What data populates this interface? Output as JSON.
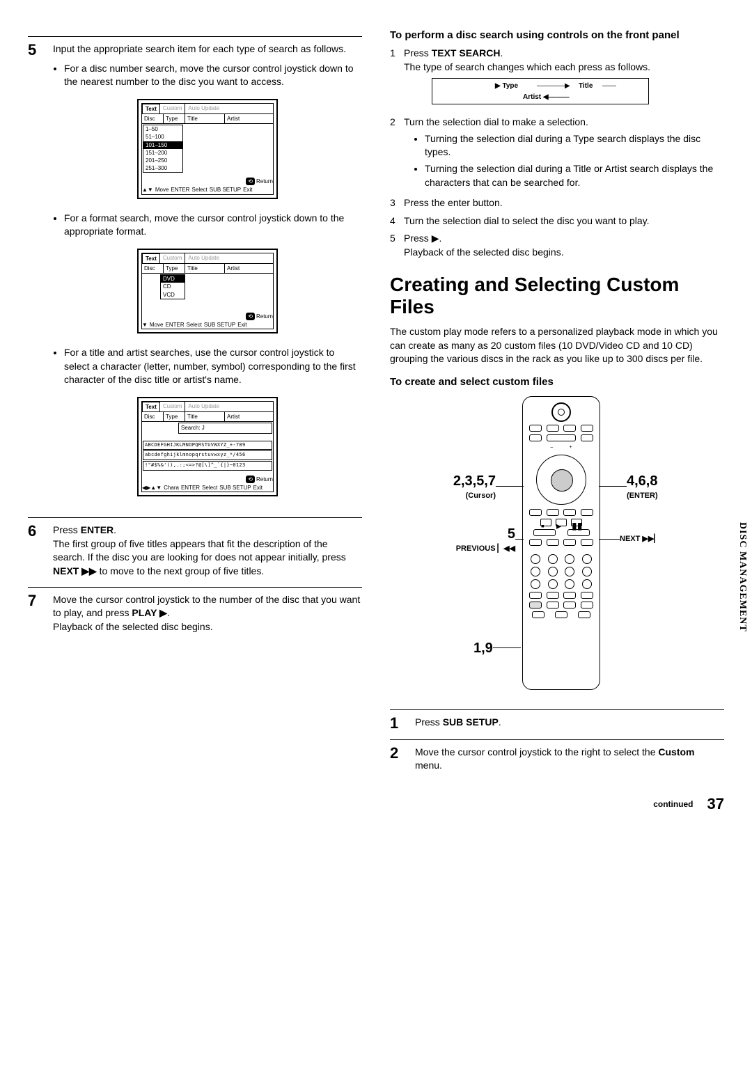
{
  "sideTab": "DISC MANAGEMENT",
  "pageNumber": "37",
  "continued": "continued",
  "left": {
    "step5": {
      "num": "5",
      "text": "Input the appropriate search item for each type of search as follows.",
      "b1": "For a disc number search, move the cursor control joystick down to the nearest number to the disc you want to access.",
      "fig1": {
        "t_text": "Text",
        "t_custom": "Custom",
        "t_auto": "Auto Update",
        "h_disc": "Disc",
        "h_type": "Type",
        "h_title": "Title",
        "h_artist": "Artist",
        "r1": "1–50",
        "r2": "51–100",
        "r3": "101–150",
        "r4": "151–200",
        "r5": "201–250",
        "r6": "251–300",
        "ret": "Return",
        "move": "Move",
        "enter": "ENTER",
        "select": "Select",
        "sub": "SUB SETUP",
        "exit": "Exit"
      },
      "b2": "For a format search, move the cursor control joystick down to the appropriate format.",
      "fig2": {
        "opt1": "DVD",
        "opt2": "CD",
        "opt3": "VCD"
      },
      "b3": "For a title and artist searches, use the cursor control joystick to select a character (letter, number, symbol) corresponding to the first character of the disc title or artist's name.",
      "fig3": {
        "search": "Search: J",
        "row1": "ABCDEFGHIJKLMNOPQRSTUVWXYZ_+-789",
        "row2": "abcdefghijklmnopqrstuvwxyz_*/456",
        "row3": "!\"#$%&'(),.:;<=>?@[\\]^_`{|}~0123",
        "chara": "Chara"
      }
    },
    "step6": {
      "num": "6",
      "press": "Press ",
      "enter": "ENTER",
      "period": ".",
      "para": "The first group of five titles appears that fit the description of the search. If the disc you are looking for does not appear initially, press ",
      "next": "NEXT ▶▶",
      "rest": " to move to the next group of five titles."
    },
    "step7": {
      "num": "7",
      "t1": "Move the cursor control joystick to the number of the disc that you want to play, and press ",
      "play": "PLAY ▶",
      "period": ".",
      "t2": "Playback of the selected disc begins."
    }
  },
  "right": {
    "heading1": "To perform a disc search using controls on the front panel",
    "s1_pre": "Press ",
    "s1_bold": "TEXT SEARCH",
    "s1_post": ".",
    "s1_desc": "The type of search changes which each press as follows.",
    "cycle": {
      "type": "Type",
      "title": "Title",
      "artist": "Artist"
    },
    "s2": "Turn the selection dial to make a selection.",
    "s2b1": "Turning the selection dial during a Type search displays the disc types.",
    "s2b2": "Turning the selection dial during a Title or Artist search displays the characters that can be searched for.",
    "s3": "Press the enter button.",
    "s4": "Turn the selection dial to select the disc you want to play.",
    "s5_pre": "Press ",
    "s5_sym": "▶",
    "s5_post": ".",
    "s5_desc": "Playback of the selected disc begins.",
    "bigTitle": "Creating and Selecting Custom Files",
    "intro": "The custom play mode refers to a personalized playback mode in which you can create as many as 20 custom files (10 DVD/Video CD and 10 CD) grouping the various discs in the rack as you like up to 300 discs per file.",
    "sub": "To create and select custom files",
    "labels": {
      "l2357": "2,3,5,7",
      "cursor": "(Cursor)",
      "l468": "4,6,8",
      "enter": "(ENTER)",
      "l5": "5",
      "prev": "PREVIOUS ",
      "prevSym": "▏◀◀",
      "next": "NEXT ",
      "nextSym": "▶▶▏",
      "l19": "1,9"
    },
    "step1": {
      "num": "1",
      "pre": "Press ",
      "bold": "SUB SETUP",
      "post": "."
    },
    "step2": {
      "num": "2",
      "t1": "Move the cursor control joystick to the right to select the ",
      "bold": "Custom",
      "t2": " menu."
    }
  }
}
